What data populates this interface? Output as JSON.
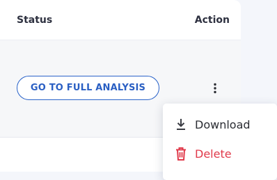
{
  "table": {
    "headers": {
      "status": "Status",
      "action": "Action"
    },
    "row": {
      "analysis_button_label": "GO TO FULL ANALYSIS"
    }
  },
  "row_menu": {
    "items": [
      {
        "label": "Download",
        "icon": "download-icon"
      },
      {
        "label": "Delete",
        "icon": "trash-icon",
        "color": "#e0394a"
      }
    ]
  },
  "colors": {
    "primary": "#2a63c9",
    "danger": "#e0394a",
    "row_background": "#f6f7f9"
  }
}
